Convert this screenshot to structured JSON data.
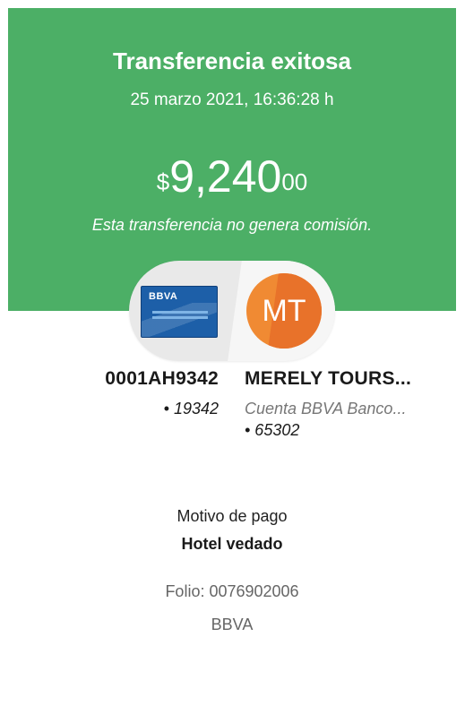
{
  "header": {
    "title": "Transferencia exitosa",
    "datetime": "25 marzo 2021, 16:36:28 h"
  },
  "amount": {
    "currency_symbol": "$",
    "integer": "9,240",
    "cents": "00"
  },
  "commission_note": "Esta transferencia no genera comisión.",
  "origin": {
    "card_logo": "BBVA",
    "account": "0001AH9342",
    "suffix": "• 19342"
  },
  "destination": {
    "initials": "MT",
    "name": "MERELY TOURS...",
    "bank": "Cuenta BBVA Banco...",
    "suffix": "• 65302"
  },
  "details": {
    "reason_label": "Motivo de pago",
    "reason_value": "Hotel vedado",
    "folio": "Folio: 0076902006",
    "bank": "BBVA"
  },
  "colors": {
    "success_green": "#4caf66",
    "avatar_orange": "#f08a33",
    "card_blue": "#1d5fa8"
  }
}
